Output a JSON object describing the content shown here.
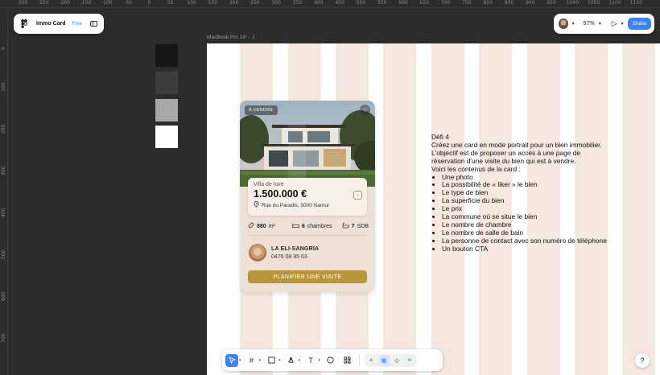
{
  "ruler": {
    "top": [
      "-400",
      "-350",
      "-300",
      "-250",
      "-200",
      "-150",
      "-100",
      "-50",
      "0",
      "50",
      "100",
      "150",
      "200",
      "250",
      "300",
      "350",
      "400",
      "450",
      "500",
      "550",
      "600",
      "650",
      "700",
      "750",
      "800",
      "850",
      "900",
      "950",
      "1000",
      "1050",
      "1100",
      "1150"
    ],
    "left": [
      "0",
      "100",
      "200",
      "300",
      "400",
      "500",
      "600",
      "700"
    ]
  },
  "project": {
    "name": "Immo Card",
    "plan": "Free",
    "logo_icon": "figma-logo-icon",
    "panel_icon": "sidebar-toggle-icon"
  },
  "topbar": {
    "zoom": "97%",
    "share_label": "Share"
  },
  "swatches": [
    "#161616",
    "#3d3d3d",
    "#a8a8a8",
    "#ffffff"
  ],
  "frame": {
    "label": "MacBook Pro 14\" - 1",
    "column_color": "#f6e8e0"
  },
  "card": {
    "badge": "À VENDRE",
    "type": "Villa de luxe",
    "price": "1.500.000 €",
    "address": "Rue du Paradis, 5000 Namur",
    "features": {
      "surface_value": "880",
      "surface_unit": "m²",
      "rooms_value": "6",
      "rooms_unit": "chambres",
      "baths_value": "7",
      "baths_unit": "SDB"
    },
    "contact": {
      "name": "LA ELI-SANGRIA",
      "phone": "0476 08 95 63"
    },
    "cta": "PLANIFIER UNE VISITE",
    "accent_color": "#b8963c"
  },
  "brief": {
    "title": "Défi 4",
    "lines": [
      "Créez une card en mode portrait pour un bien immobilier.",
      "L'objectif est de proposer un accès à une page de",
      "réservation d'une visite du bien qui est à vendre.",
      "Voici les contenus de la card :"
    ],
    "items": [
      "Une photo",
      "La possibilité de « liker » le bien",
      "Le type de bien",
      "La superficie du bien",
      "Le prix",
      "La commune où se situe le bien",
      "Le nombre de chambre",
      "Le nombre de salle de bain",
      "La personne de contact avec son numéro de téléphone",
      "Un bouton CTA"
    ]
  },
  "toolbar": {
    "tools": [
      "cursor-icon",
      "frame-icon",
      "rectangle-icon",
      "pen-icon",
      "text-icon",
      "comment-icon",
      "components-icon"
    ],
    "mode_tools": [
      "prototype-icon",
      "design-icon",
      "dev-mode-icon",
      "code-icon"
    ]
  },
  "help_label": "?"
}
